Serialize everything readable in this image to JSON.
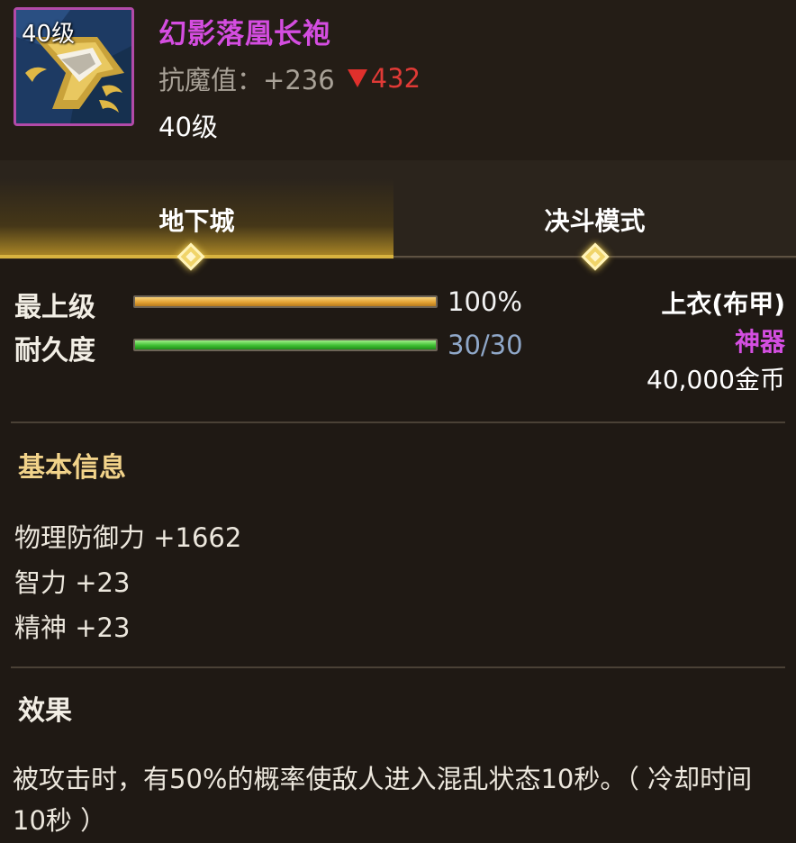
{
  "item": {
    "icon_level": "40级",
    "name": "幻影落凰长袍",
    "stat_label": "抗魔值：",
    "stat_value": "+236",
    "stat_compare": "432",
    "required_level": "40级"
  },
  "tabs": {
    "items": [
      {
        "label": "地下城",
        "active": true
      },
      {
        "label": "决斗模式",
        "active": false
      }
    ]
  },
  "bars": {
    "top_grade": {
      "label": "最上级",
      "value_text": "100%",
      "fraction": 1.0
    },
    "durability": {
      "label": "耐久度",
      "value_text": "30/30",
      "fraction": 1.0
    }
  },
  "info": {
    "slot": "上衣(布甲)",
    "rarity": "神器",
    "price": "40,000金币"
  },
  "basic": {
    "title": "基本信息",
    "attributes": [
      "物理防御力 +1662",
      "智力 +23",
      "精神 +23"
    ]
  },
  "effect": {
    "title": "效果",
    "text": "被攻击时，有50%的概率使敌人进入混乱状态10秒。（ 冷却时间10秒 ）"
  },
  "colors": {
    "name": "#d44de0",
    "rarity": "#d34ee0",
    "down_arrow": "#e03a36",
    "section_title": "#f2d38a",
    "tab_active": "#d8b33f",
    "orange_bar": "#e3a234",
    "green_bar": "#3fbf33"
  },
  "icons": {
    "item_icon": "robe-item-icon",
    "compare_down": "down-triangle-icon",
    "tab_marker": "diamond-icon"
  }
}
